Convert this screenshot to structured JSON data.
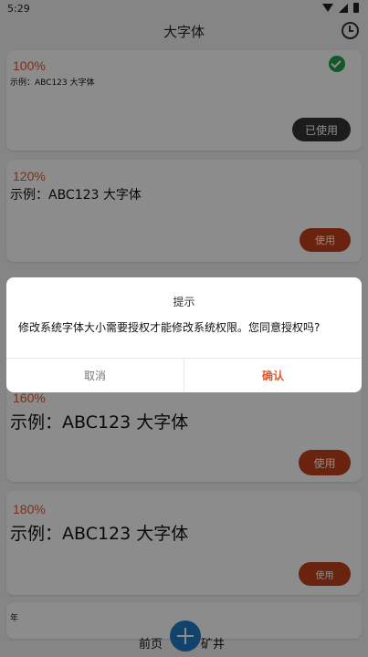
{
  "status_bar": {
    "time": "5:29"
  },
  "app_bar": {
    "title": "大字体"
  },
  "cards": [
    {
      "percent": "100%",
      "sample": "示例：ABC123 大字体",
      "button": "已使用",
      "in_use": true
    },
    {
      "percent": "120%",
      "sample": "示例：ABC123 大字体",
      "button": "使用",
      "in_use": false
    },
    {
      "percent": "160%",
      "sample": "示例：ABC123 大字体",
      "button": "使用",
      "in_use": false
    },
    {
      "percent": "180%",
      "sample": "示例：ABC123 大字体",
      "button": "使用",
      "in_use": false
    }
  ],
  "partial_card_text": "年",
  "bottom_nav": {
    "left": "前页",
    "right": "矿井"
  },
  "dialog": {
    "title": "提示",
    "message": "修改系统字体大小需要授权才能修改系统权限。您同意授权吗?",
    "cancel": "取消",
    "confirm": "确认"
  },
  "colors": {
    "accent": "#e0582e",
    "button": "#c2411a",
    "check": "#23a049",
    "fab": "#1f7ac5"
  }
}
